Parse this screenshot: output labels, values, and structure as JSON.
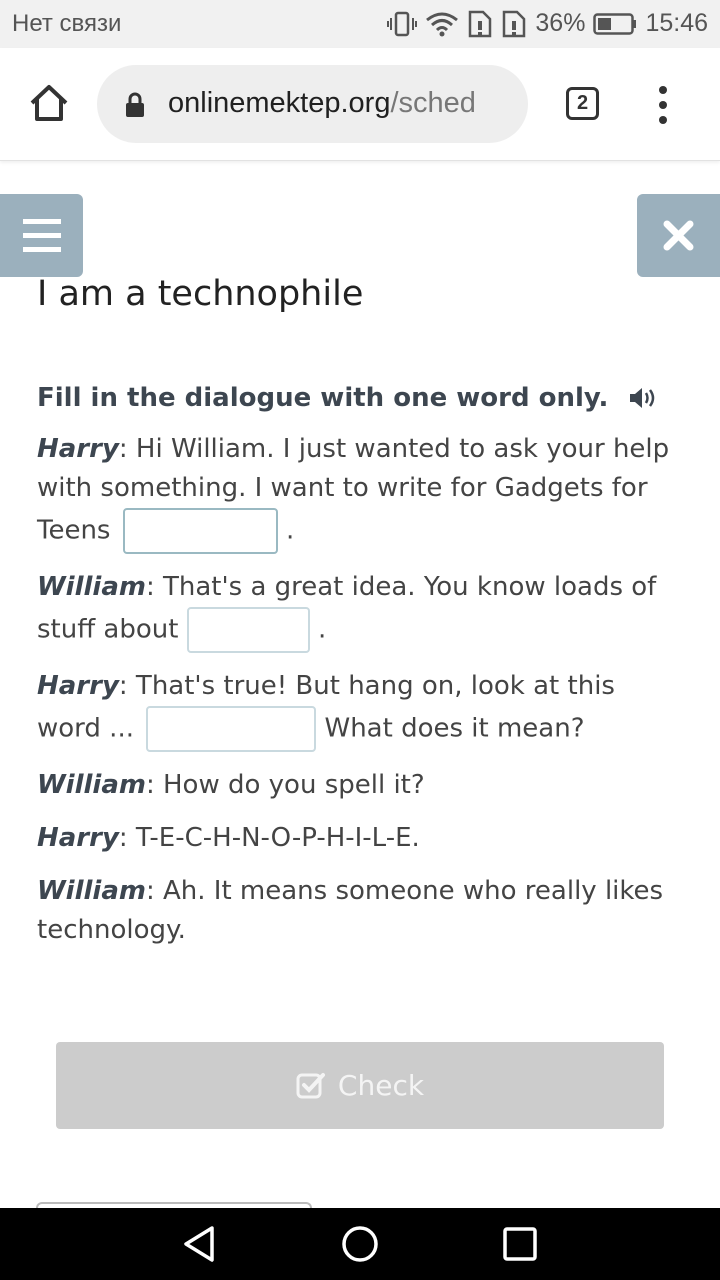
{
  "status_bar": {
    "carrier": "Нет связи",
    "battery": "36%",
    "time": "15:46",
    "icons": [
      "vibrate-icon",
      "wifi-icon",
      "sim-icon",
      "sim-icon",
      "battery-icon"
    ]
  },
  "browser": {
    "url_domain": "onlinemektep.org",
    "url_path": "/sched",
    "tab_count": "2"
  },
  "page": {
    "title": "I am a technophile",
    "instruction": "Fill in the dialogue with one word only.",
    "dialogue": [
      {
        "speaker": "Harry",
        "parts": [
          ": Hi William. I just wanted to ask your help with something. I want to write for Gadgets for Teens ",
          " ."
        ]
      },
      {
        "speaker": "William",
        "parts": [
          ": That's a great idea. You know loads of stuff about ",
          " ."
        ]
      },
      {
        "speaker": "Harry",
        "parts": [
          ": That's true! But hang on, look at this word ... ",
          " What does it mean?"
        ]
      },
      {
        "speaker": "William",
        "text": ": How do you spell it?"
      },
      {
        "speaker": "Harry",
        "text": ": T-E-C-H-N-O-P-H-I-L-E."
      },
      {
        "speaker": "William",
        "text": ": Ah. It means someone who really likes technology."
      }
    ],
    "blanks": [
      "",
      "",
      ""
    ],
    "check_label": "Check"
  },
  "colors": {
    "side_buttons": "#9bb0bd",
    "check_button": "#cccccc",
    "heading_text": "#3d4650"
  }
}
